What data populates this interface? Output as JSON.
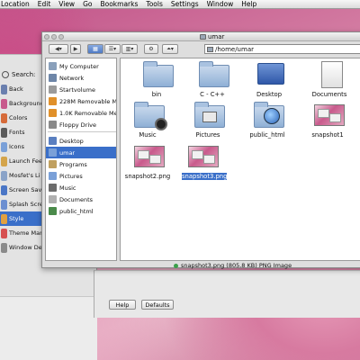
{
  "menubar": {
    "items": [
      "Location",
      "Edit",
      "View",
      "Go",
      "Bookmarks",
      "Tools",
      "Settings",
      "Window",
      "Help"
    ]
  },
  "settings_window": {
    "search_label": "Search:",
    "items": [
      {
        "label": "Back",
        "icon": "back-icon",
        "color": "#6a7fae"
      },
      {
        "label": "Background",
        "icon": "background-icon",
        "color": "#c85a8c"
      },
      {
        "label": "Colors",
        "icon": "colors-icon",
        "color": "#d66b3a"
      },
      {
        "label": "Fonts",
        "icon": "fonts-icon",
        "color": "#5a5a5a"
      },
      {
        "label": "Icons",
        "icon": "icons-icon",
        "color": "#7aa0d8"
      },
      {
        "label": "Launch Fee",
        "icon": "launch-feedback-icon",
        "color": "#d4a44a"
      },
      {
        "label": "Mosfet's Li",
        "icon": "mosfet-icon",
        "color": "#8aa3c8"
      },
      {
        "label": "Screen Sav",
        "icon": "screensaver-icon",
        "color": "#4a76c6"
      },
      {
        "label": "Splash Scre",
        "icon": "splash-icon",
        "color": "#6c8fd1"
      },
      {
        "label": "Style",
        "icon": "style-icon",
        "color": "#e0a040",
        "selected": true
      },
      {
        "label": "Theme Man",
        "icon": "theme-manager-icon",
        "color": "#d65050"
      },
      {
        "label": "Window De",
        "icon": "window-deco-icon",
        "color": "#8a8a8a"
      }
    ],
    "help_button": "Help",
    "defaults_button": "Defaults"
  },
  "file_manager": {
    "title": "umar",
    "address": "/home/umar",
    "sidebar": [
      {
        "label": "My Computer",
        "icon": "computer-icon",
        "color": "#8aa0bb"
      },
      {
        "label": "Network",
        "icon": "network-icon",
        "color": "#6e86a8"
      },
      {
        "label": "Startvolume",
        "icon": "hard-drive-icon",
        "color": "#9b9b9b"
      },
      {
        "label": "228M Removable Media",
        "icon": "removable-media-icon",
        "color": "#e0902a"
      },
      {
        "label": "1.0K Removable Media",
        "icon": "removable-media-icon",
        "color": "#e0902a"
      },
      {
        "label": "Floppy Drive",
        "icon": "floppy-icon",
        "color": "#8a8a8a"
      },
      {
        "label": "Desktop",
        "icon": "desktop-icon",
        "color": "#5a7fc0"
      },
      {
        "label": "umar",
        "icon": "home-folder-icon",
        "color": "#7aa0d8",
        "selected": true
      },
      {
        "label": "Programs",
        "icon": "programs-icon",
        "color": "#c0a060"
      },
      {
        "label": "Pictures",
        "icon": "pictures-icon",
        "color": "#7aa0d8"
      },
      {
        "label": "Music",
        "icon": "music-icon",
        "color": "#6c6c6c"
      },
      {
        "label": "Documents",
        "icon": "documents-icon",
        "color": "#b0b0b0"
      },
      {
        "label": "public_html",
        "icon": "public-html-icon",
        "color": "#4a8a4a"
      }
    ],
    "files": [
      {
        "name": "bin",
        "kind": "folder"
      },
      {
        "name": "C - C++",
        "kind": "folder"
      },
      {
        "name": "Desktop",
        "kind": "desktop"
      },
      {
        "name": "Documents",
        "kind": "documents"
      },
      {
        "name": "Music",
        "kind": "music-folder"
      },
      {
        "name": "Pictures",
        "kind": "pictures-folder"
      },
      {
        "name": "public_html",
        "kind": "web-folder"
      },
      {
        "name": "snapshot1",
        "kind": "image"
      },
      {
        "name": "snapshot2.png",
        "kind": "image"
      },
      {
        "name": "snapshot3.png",
        "kind": "image",
        "selected": true
      }
    ],
    "status": "snapshot3.png (805.8 KB) PNG Image"
  },
  "colors": {
    "selection": "#3a6fc9",
    "folder": "#8fb0d6"
  }
}
